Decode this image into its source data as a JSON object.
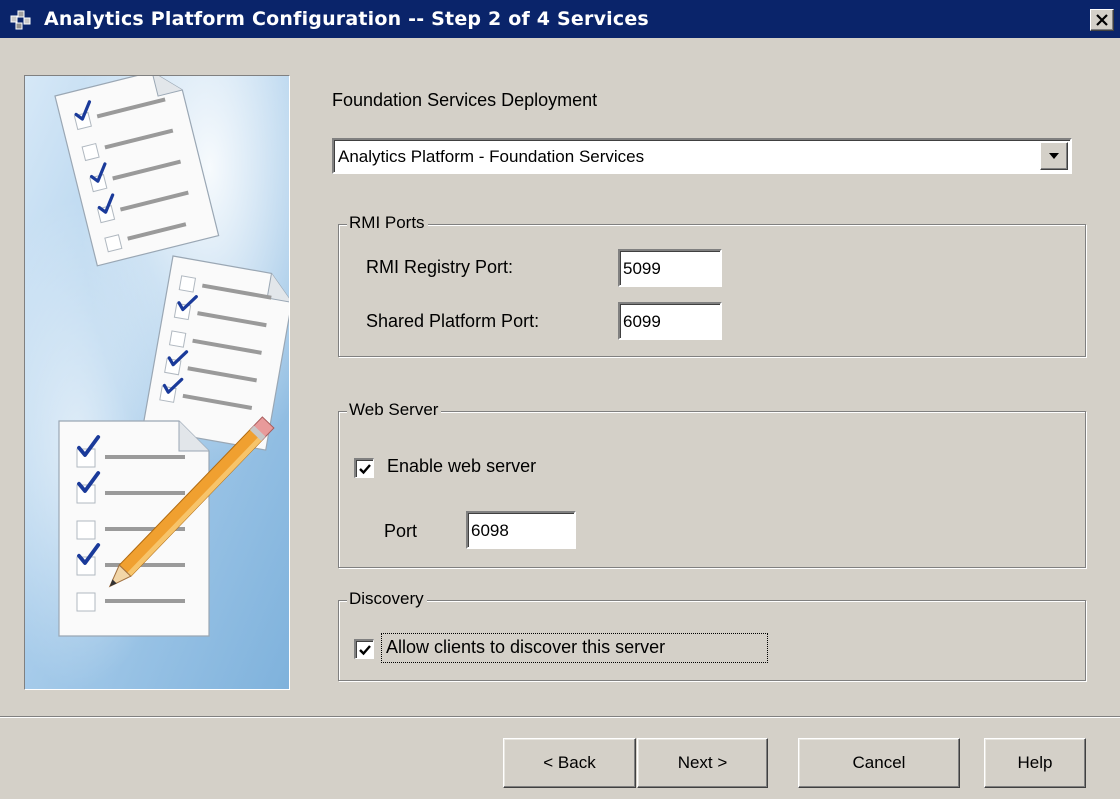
{
  "window": {
    "title": "Analytics Platform Configuration  -- Step 2 of 4  Services"
  },
  "deployment": {
    "label": "Foundation Services Deployment",
    "selected": "Analytics Platform - Foundation Services"
  },
  "rmi_ports": {
    "title": "RMI Ports",
    "registry_label": "RMI Registry Port:",
    "registry_value": "5099",
    "shared_label": "Shared Platform Port:",
    "shared_value": "6099"
  },
  "web_server": {
    "title": "Web Server",
    "enable_label": "Enable web server",
    "enable_checked": true,
    "port_label": "Port",
    "port_value": "6098"
  },
  "discovery": {
    "title": "Discovery",
    "allow_label": "Allow clients to discover this server",
    "allow_checked": true
  },
  "buttons": {
    "back": "< Back",
    "next": "Next >",
    "cancel": "Cancel",
    "help": "Help"
  },
  "icons": {
    "title": "wizard-app-icon",
    "close": "close-icon",
    "dropdown": "chevron-down-icon",
    "check": "checkmark-icon",
    "illustration": "checklist-illustration"
  },
  "colors": {
    "titlebar": "#0a246a",
    "dialog_background": "#d4d0c8",
    "checkmark": "#1a3a9a",
    "pencil": "#f0a030"
  }
}
